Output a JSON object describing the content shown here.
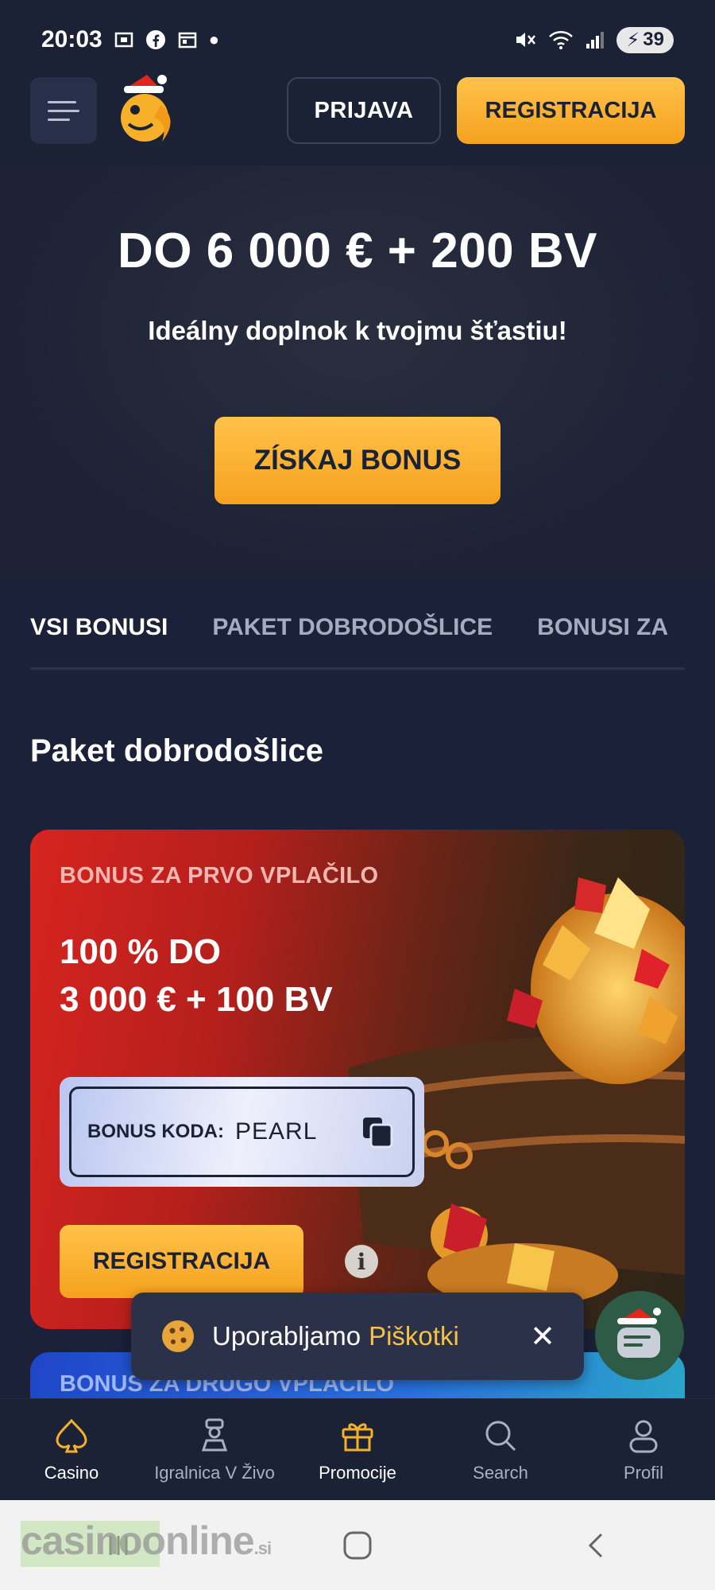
{
  "status_bar": {
    "time": "20:03",
    "battery": "39"
  },
  "header": {
    "login_label": "PRIJAVA",
    "register_label": "REGISTRACIJA"
  },
  "hero": {
    "title": "DO 6 000 € + 200 BV",
    "subtitle": "Ideálny doplnok k tvojmu šťastiu!",
    "cta_label": "ZÍSKAJ BONUS"
  },
  "tabs": [
    {
      "label": "VSI BONUSI",
      "active": true
    },
    {
      "label": "PAKET DOBRODOŠLICE",
      "active": false
    },
    {
      "label": "BONUSI ZA",
      "active": false
    }
  ],
  "section": {
    "title": "Paket dobrodošlice"
  },
  "promo_card": {
    "kicker": "BONUS ZA PRVO VPLAČILO",
    "headline_line1": "100 % DO",
    "headline_line2": "3 000 € + 100 BV",
    "code_label": "BONUS KODA:",
    "code_value": "PEARL",
    "cta_label": "REGISTRACIJA",
    "info_glyph": "i"
  },
  "promo_card_2": {
    "kicker": "BONUS ZA DRUGO VPLAČILO"
  },
  "cookie": {
    "text": "Uporabljamo",
    "link": "Piškotki",
    "close": "✕"
  },
  "bottom_nav": [
    {
      "label": "Casino",
      "icon": "spade-icon"
    },
    {
      "label": "Igralnica V Živo",
      "icon": "dealer-icon"
    },
    {
      "label": "Promocije",
      "icon": "gift-icon"
    },
    {
      "label": "Search",
      "icon": "search-icon"
    },
    {
      "label": "Profil",
      "icon": "profile-icon"
    }
  ],
  "watermark": {
    "main": "casinoonline",
    "suffix": ".si"
  },
  "colors": {
    "accent": "#f6b02a",
    "background": "#1a2138",
    "header": "#1b2236"
  }
}
